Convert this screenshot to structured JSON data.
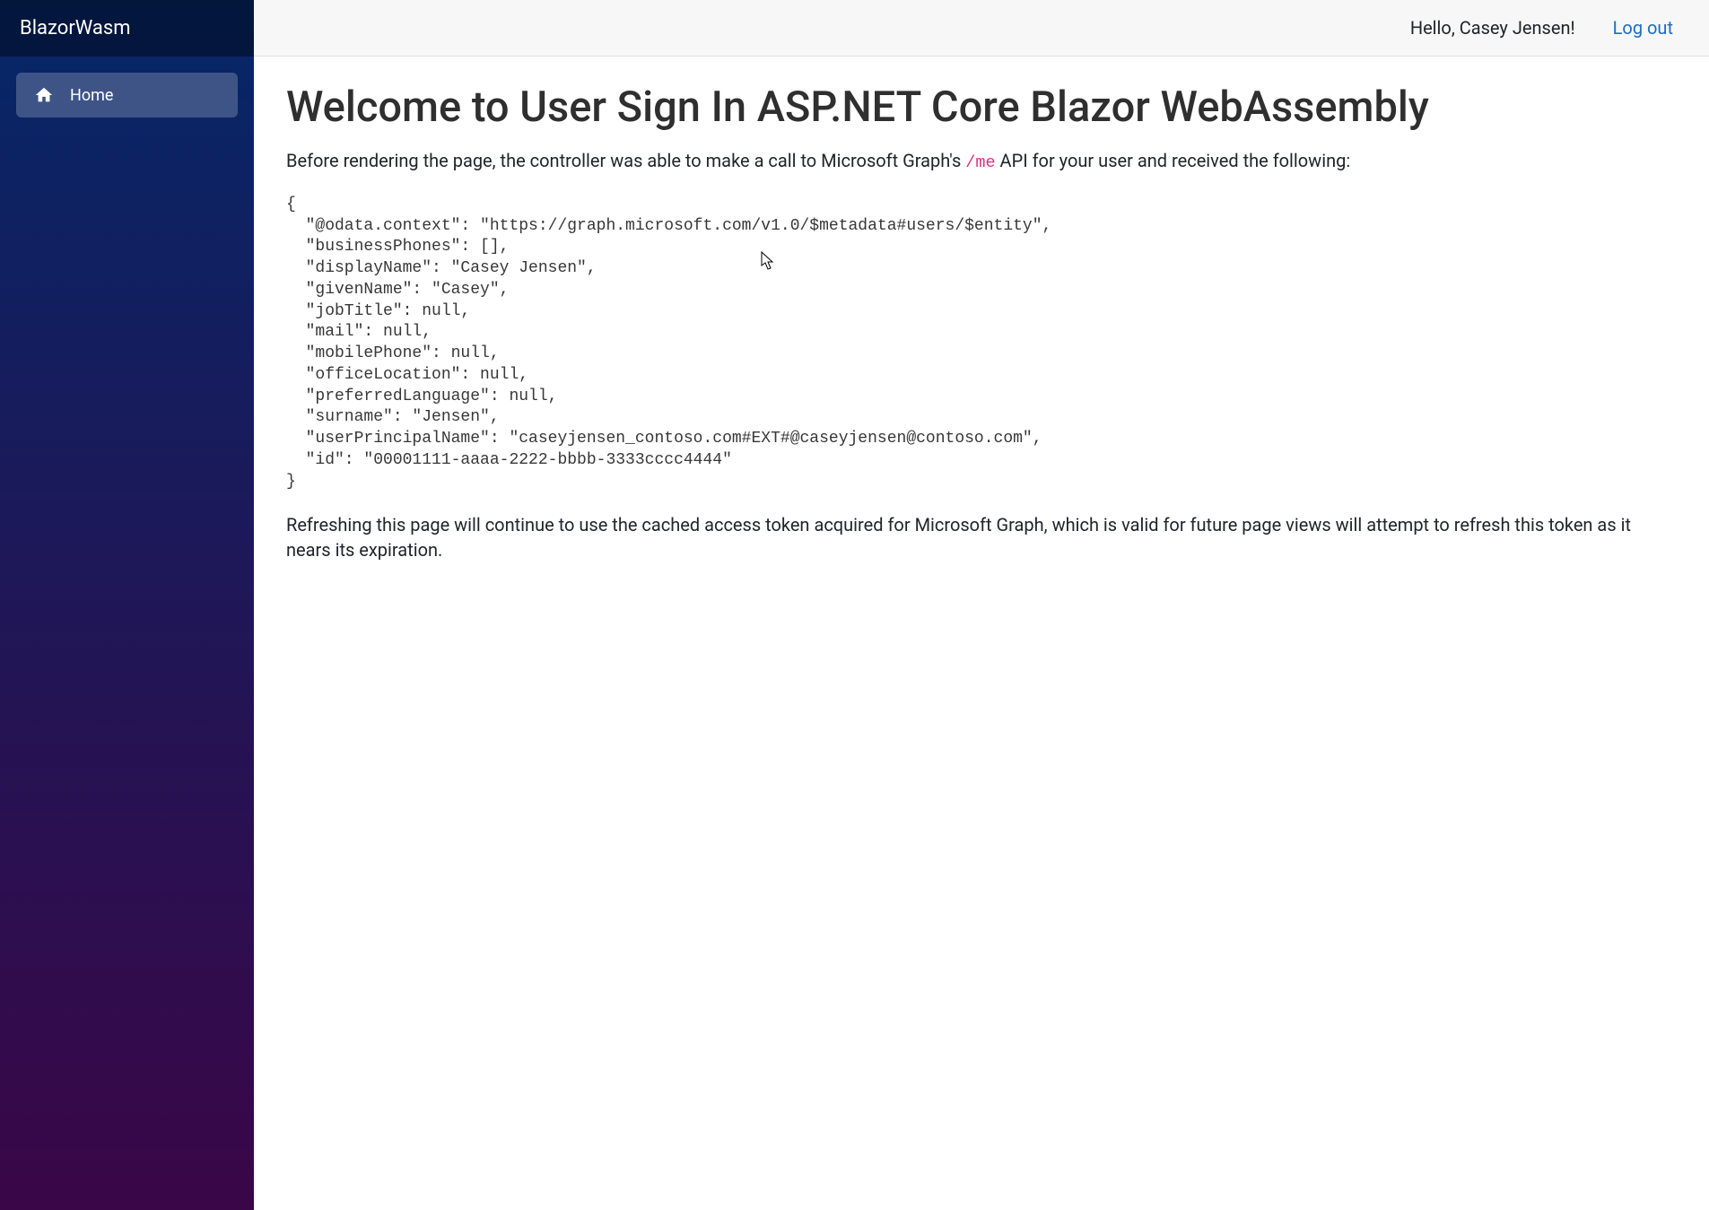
{
  "sidebar": {
    "brand": "BlazorWasm",
    "items": [
      {
        "label": "Home",
        "icon": "home-icon"
      }
    ]
  },
  "header": {
    "greeting": "Hello, Casey Jensen!",
    "logout_label": "Log out"
  },
  "main": {
    "title": "Welcome to User Sign In ASP.NET Core Blazor WebAssembly",
    "intro_before": "Before rendering the page, the controller was able to make a call to Microsoft Graph's ",
    "intro_code": "/me",
    "intro_after": " API for your user and received the following:",
    "api_response": "{\n  \"@odata.context\": \"https://graph.microsoft.com/v1.0/$metadata#users/$entity\",\n  \"businessPhones\": [],\n  \"displayName\": \"Casey Jensen\",\n  \"givenName\": \"Casey\",\n  \"jobTitle\": null,\n  \"mail\": null,\n  \"mobilePhone\": null,\n  \"officeLocation\": null,\n  \"preferredLanguage\": null,\n  \"surname\": \"Jensen\",\n  \"userPrincipalName\": \"caseyjensen_contoso.com#EXT#@caseyjensen@contoso.com\",\n  \"id\": \"00001111-aaaa-2222-bbbb-3333cccc4444\"\n}",
    "footer_text": "Refreshing this page will continue to use the cached access token acquired for Microsoft Graph, which is valid for future page views will attempt to refresh this token as it nears its expiration."
  }
}
